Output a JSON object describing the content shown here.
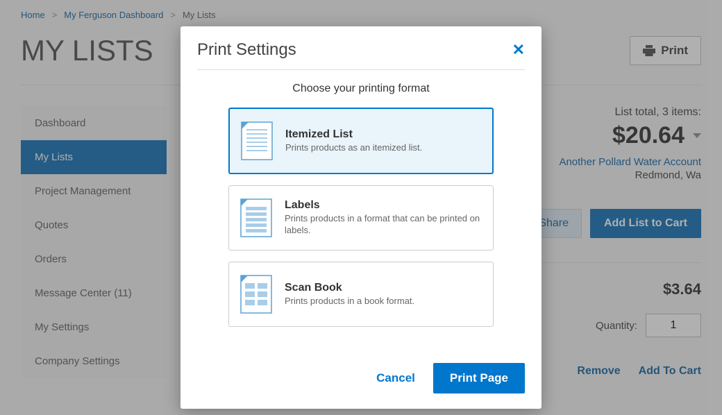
{
  "breadcrumb": {
    "home": "Home",
    "dash": "My Ferguson Dashboard",
    "current": "My Lists"
  },
  "page": {
    "title": "MY LISTS"
  },
  "header_actions": {
    "print": "Print"
  },
  "sidebar": {
    "items": [
      {
        "label": "Dashboard"
      },
      {
        "label": "My Lists"
      },
      {
        "label": "Project Management"
      },
      {
        "label": "Quotes"
      },
      {
        "label": "Orders"
      },
      {
        "label": "Message Center (11)"
      },
      {
        "label": "My Settings"
      },
      {
        "label": "Company Settings"
      }
    ],
    "active_index": 1
  },
  "summary": {
    "label": "List total, 3 items:",
    "total": "$20.64",
    "account_name": "Another Pollard Water Account",
    "account_location": "Redmond, Wa"
  },
  "actions": {
    "share": "Share",
    "add_list": "Add List to Cart"
  },
  "item": {
    "price": "$3.64",
    "qty_label": "Quantity:",
    "qty_value": "1",
    "remove": "Remove",
    "add_cart": "Add To Cart"
  },
  "modal": {
    "title": "Print Settings",
    "subtitle": "Choose your printing format",
    "options": [
      {
        "title": "Itemized List",
        "desc": "Prints products as an itemized list."
      },
      {
        "title": "Labels",
        "desc": "Prints products in a format that can be printed on labels."
      },
      {
        "title": "Scan Book",
        "desc": "Prints products in a book format."
      }
    ],
    "selected_index": 0,
    "cancel": "Cancel",
    "print_page": "Print Page"
  }
}
